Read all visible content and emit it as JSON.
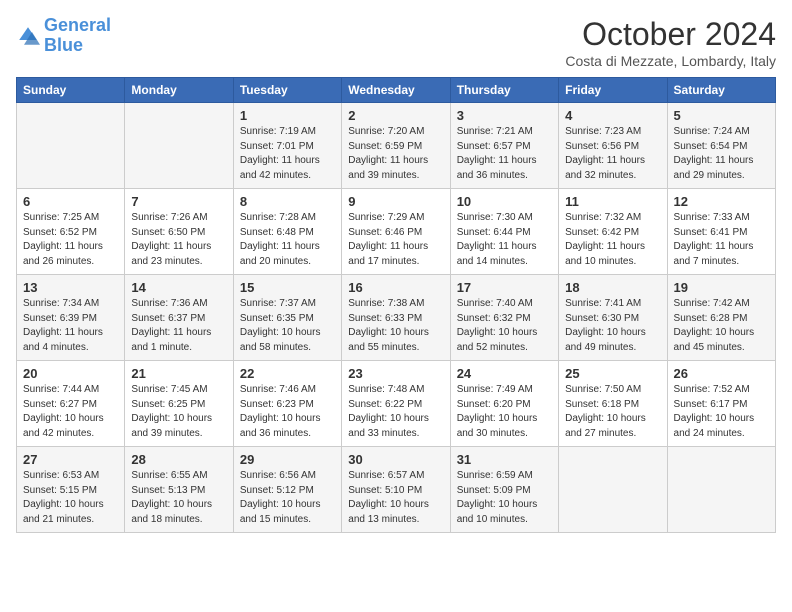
{
  "logo": {
    "line1": "General",
    "line2": "Blue"
  },
  "title": "October 2024",
  "location": "Costa di Mezzate, Lombardy, Italy",
  "weekdays": [
    "Sunday",
    "Monday",
    "Tuesday",
    "Wednesday",
    "Thursday",
    "Friday",
    "Saturday"
  ],
  "weeks": [
    [
      {
        "day": "",
        "info": ""
      },
      {
        "day": "",
        "info": ""
      },
      {
        "day": "1",
        "info": "Sunrise: 7:19 AM\nSunset: 7:01 PM\nDaylight: 11 hours\nand 42 minutes."
      },
      {
        "day": "2",
        "info": "Sunrise: 7:20 AM\nSunset: 6:59 PM\nDaylight: 11 hours\nand 39 minutes."
      },
      {
        "day": "3",
        "info": "Sunrise: 7:21 AM\nSunset: 6:57 PM\nDaylight: 11 hours\nand 36 minutes."
      },
      {
        "day": "4",
        "info": "Sunrise: 7:23 AM\nSunset: 6:56 PM\nDaylight: 11 hours\nand 32 minutes."
      },
      {
        "day": "5",
        "info": "Sunrise: 7:24 AM\nSunset: 6:54 PM\nDaylight: 11 hours\nand 29 minutes."
      }
    ],
    [
      {
        "day": "6",
        "info": "Sunrise: 7:25 AM\nSunset: 6:52 PM\nDaylight: 11 hours\nand 26 minutes."
      },
      {
        "day": "7",
        "info": "Sunrise: 7:26 AM\nSunset: 6:50 PM\nDaylight: 11 hours\nand 23 minutes."
      },
      {
        "day": "8",
        "info": "Sunrise: 7:28 AM\nSunset: 6:48 PM\nDaylight: 11 hours\nand 20 minutes."
      },
      {
        "day": "9",
        "info": "Sunrise: 7:29 AM\nSunset: 6:46 PM\nDaylight: 11 hours\nand 17 minutes."
      },
      {
        "day": "10",
        "info": "Sunrise: 7:30 AM\nSunset: 6:44 PM\nDaylight: 11 hours\nand 14 minutes."
      },
      {
        "day": "11",
        "info": "Sunrise: 7:32 AM\nSunset: 6:42 PM\nDaylight: 11 hours\nand 10 minutes."
      },
      {
        "day": "12",
        "info": "Sunrise: 7:33 AM\nSunset: 6:41 PM\nDaylight: 11 hours\nand 7 minutes."
      }
    ],
    [
      {
        "day": "13",
        "info": "Sunrise: 7:34 AM\nSunset: 6:39 PM\nDaylight: 11 hours\nand 4 minutes."
      },
      {
        "day": "14",
        "info": "Sunrise: 7:36 AM\nSunset: 6:37 PM\nDaylight: 11 hours\nand 1 minute."
      },
      {
        "day": "15",
        "info": "Sunrise: 7:37 AM\nSunset: 6:35 PM\nDaylight: 10 hours\nand 58 minutes."
      },
      {
        "day": "16",
        "info": "Sunrise: 7:38 AM\nSunset: 6:33 PM\nDaylight: 10 hours\nand 55 minutes."
      },
      {
        "day": "17",
        "info": "Sunrise: 7:40 AM\nSunset: 6:32 PM\nDaylight: 10 hours\nand 52 minutes."
      },
      {
        "day": "18",
        "info": "Sunrise: 7:41 AM\nSunset: 6:30 PM\nDaylight: 10 hours\nand 49 minutes."
      },
      {
        "day": "19",
        "info": "Sunrise: 7:42 AM\nSunset: 6:28 PM\nDaylight: 10 hours\nand 45 minutes."
      }
    ],
    [
      {
        "day": "20",
        "info": "Sunrise: 7:44 AM\nSunset: 6:27 PM\nDaylight: 10 hours\nand 42 minutes."
      },
      {
        "day": "21",
        "info": "Sunrise: 7:45 AM\nSunset: 6:25 PM\nDaylight: 10 hours\nand 39 minutes."
      },
      {
        "day": "22",
        "info": "Sunrise: 7:46 AM\nSunset: 6:23 PM\nDaylight: 10 hours\nand 36 minutes."
      },
      {
        "day": "23",
        "info": "Sunrise: 7:48 AM\nSunset: 6:22 PM\nDaylight: 10 hours\nand 33 minutes."
      },
      {
        "day": "24",
        "info": "Sunrise: 7:49 AM\nSunset: 6:20 PM\nDaylight: 10 hours\nand 30 minutes."
      },
      {
        "day": "25",
        "info": "Sunrise: 7:50 AM\nSunset: 6:18 PM\nDaylight: 10 hours\nand 27 minutes."
      },
      {
        "day": "26",
        "info": "Sunrise: 7:52 AM\nSunset: 6:17 PM\nDaylight: 10 hours\nand 24 minutes."
      }
    ],
    [
      {
        "day": "27",
        "info": "Sunrise: 6:53 AM\nSunset: 5:15 PM\nDaylight: 10 hours\nand 21 minutes."
      },
      {
        "day": "28",
        "info": "Sunrise: 6:55 AM\nSunset: 5:13 PM\nDaylight: 10 hours\nand 18 minutes."
      },
      {
        "day": "29",
        "info": "Sunrise: 6:56 AM\nSunset: 5:12 PM\nDaylight: 10 hours\nand 15 minutes."
      },
      {
        "day": "30",
        "info": "Sunrise: 6:57 AM\nSunset: 5:10 PM\nDaylight: 10 hours\nand 13 minutes."
      },
      {
        "day": "31",
        "info": "Sunrise: 6:59 AM\nSunset: 5:09 PM\nDaylight: 10 hours\nand 10 minutes."
      },
      {
        "day": "",
        "info": ""
      },
      {
        "day": "",
        "info": ""
      }
    ]
  ]
}
